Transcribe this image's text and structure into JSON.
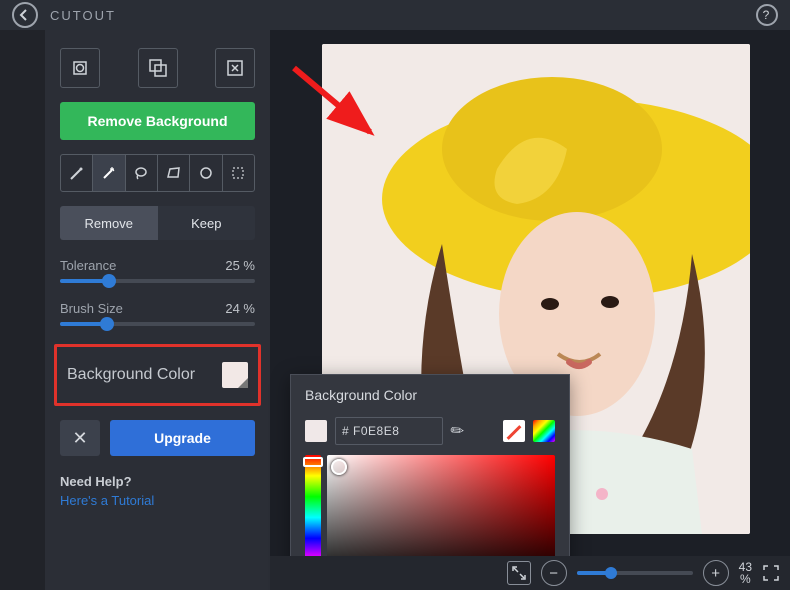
{
  "header": {
    "title": "CUTOUT"
  },
  "panel": {
    "remove_bg_label": "Remove Background",
    "mode": {
      "remove_label": "Remove",
      "keep_label": "Keep"
    },
    "tolerance": {
      "label": "Tolerance",
      "value_text": "25 %",
      "percent": 25
    },
    "brush": {
      "label": "Brush Size",
      "value_text": "24 %",
      "percent": 24
    },
    "bg_color": {
      "label": "Background Color",
      "swatch_hex": "#F0E8E8"
    },
    "upgrade": {
      "close_label": "✕",
      "upgrade_label": "Upgrade"
    },
    "help": {
      "title": "Need Help?",
      "link": "Here's a Tutorial"
    }
  },
  "popover": {
    "title": "Background Color",
    "hex_value": "# F0E8E8"
  },
  "zoom": {
    "percent_text": "43",
    "percent_unit": "%",
    "percent": 43
  }
}
